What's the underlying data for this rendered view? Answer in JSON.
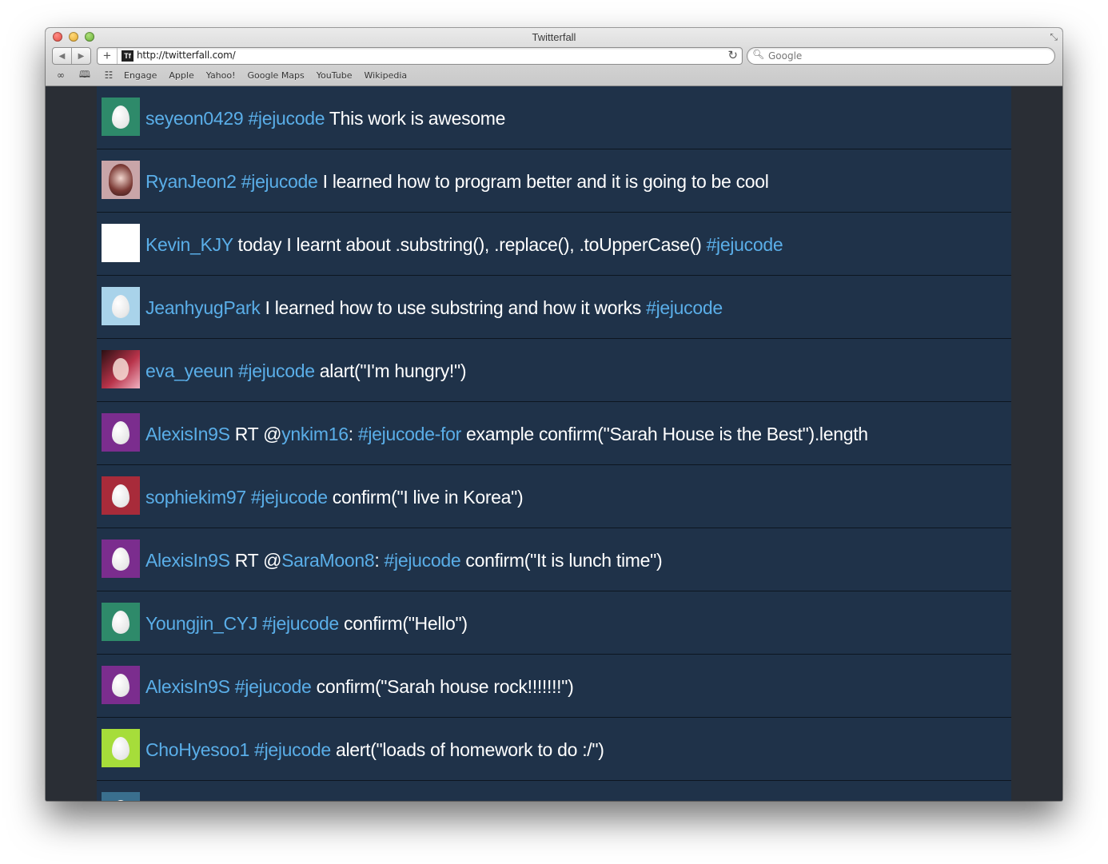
{
  "window": {
    "title": "Twitterfall"
  },
  "toolbar": {
    "back_icon": "back-arrow-icon",
    "forward_icon": "forward-arrow-icon",
    "favicon_text": "Tf",
    "url": "http://twitterfall.com/",
    "search_placeholder": "Google"
  },
  "bookmarks": [
    "Engage",
    "Apple",
    "Yahoo!",
    "Google Maps",
    "YouTube",
    "Wikipedia"
  ],
  "colors": {
    "feed_bg": "#1f3249",
    "link": "#5aaee8",
    "text": "#ffffff",
    "side_bg": "#2a2e35"
  },
  "tweets": [
    {
      "avatar": {
        "kind": "egg",
        "color": "#2e8a6a"
      },
      "segments": [
        {
          "t": "user",
          "v": "seyeon0429"
        },
        {
          "t": "text",
          "v": " "
        },
        {
          "t": "tag",
          "v": "#jejucode"
        },
        {
          "t": "text",
          "v": " This work is awesome"
        }
      ]
    },
    {
      "avatar": {
        "kind": "photo"
      },
      "segments": [
        {
          "t": "user",
          "v": "RyanJeon2"
        },
        {
          "t": "text",
          "v": " "
        },
        {
          "t": "tag",
          "v": "#jejucode"
        },
        {
          "t": "text",
          "v": " I learned how to program better and it is going to be cool"
        }
      ]
    },
    {
      "avatar": {
        "kind": "white"
      },
      "segments": [
        {
          "t": "user",
          "v": "Kevin_KJY"
        },
        {
          "t": "text",
          "v": " today I learnt about .substring(), .replace(), .toUpperCase() "
        },
        {
          "t": "tag",
          "v": "#jejucode"
        }
      ]
    },
    {
      "avatar": {
        "kind": "egg",
        "color": "#a9d3ea"
      },
      "segments": [
        {
          "t": "user",
          "v": "JeanhyugPark"
        },
        {
          "t": "text",
          "v": " I learned how to use substring and how it works "
        },
        {
          "t": "tag",
          "v": "#jejucode"
        }
      ]
    },
    {
      "avatar": {
        "kind": "pink"
      },
      "segments": [
        {
          "t": "user",
          "v": "eva_yeeun"
        },
        {
          "t": "text",
          "v": " "
        },
        {
          "t": "tag",
          "v": "#jejucode"
        },
        {
          "t": "text",
          "v": " alart(\"I'm hungry!\")"
        }
      ]
    },
    {
      "avatar": {
        "kind": "egg",
        "color": "#7b2d8e"
      },
      "segments": [
        {
          "t": "user",
          "v": "AlexisIn9S"
        },
        {
          "t": "text",
          "v": " RT @"
        },
        {
          "t": "mention",
          "v": "ynkim16"
        },
        {
          "t": "text",
          "v": ": "
        },
        {
          "t": "tag",
          "v": "#jejucode-for"
        },
        {
          "t": "text",
          "v": " example confirm(\"Sarah House is the Best\").length"
        }
      ]
    },
    {
      "avatar": {
        "kind": "egg",
        "color": "#a82b3a"
      },
      "segments": [
        {
          "t": "user",
          "v": "sophiekim97"
        },
        {
          "t": "text",
          "v": " "
        },
        {
          "t": "tag",
          "v": "#jejucode"
        },
        {
          "t": "text",
          "v": " confirm(\"I live in Korea\")"
        }
      ]
    },
    {
      "avatar": {
        "kind": "egg",
        "color": "#7b2d8e"
      },
      "segments": [
        {
          "t": "user",
          "v": "AlexisIn9S"
        },
        {
          "t": "text",
          "v": " RT @"
        },
        {
          "t": "mention",
          "v": "SaraMoon8"
        },
        {
          "t": "text",
          "v": ": "
        },
        {
          "t": "tag",
          "v": "#jejucode"
        },
        {
          "t": "text",
          "v": " confirm(\"It is lunch time\")"
        }
      ]
    },
    {
      "avatar": {
        "kind": "egg",
        "color": "#2e8a6a"
      },
      "segments": [
        {
          "t": "user",
          "v": "Youngjin_CYJ"
        },
        {
          "t": "text",
          "v": " "
        },
        {
          "t": "tag",
          "v": "#jejucode"
        },
        {
          "t": "text",
          "v": " confirm(\"Hello\")"
        }
      ]
    },
    {
      "avatar": {
        "kind": "egg",
        "color": "#7b2d8e"
      },
      "segments": [
        {
          "t": "user",
          "v": "AlexisIn9S"
        },
        {
          "t": "text",
          "v": " "
        },
        {
          "t": "tag",
          "v": "#jejucode"
        },
        {
          "t": "text",
          "v": " confirm(\"Sarah house rock!!!!!!!\")"
        }
      ]
    },
    {
      "avatar": {
        "kind": "egg",
        "color": "#a6dd3a"
      },
      "segments": [
        {
          "t": "user",
          "v": "ChoHyesoo1"
        },
        {
          "t": "text",
          "v": " "
        },
        {
          "t": "tag",
          "v": "#jejucode"
        },
        {
          "t": "text",
          "v": " alert(\"loads of homework to do :/\")"
        }
      ]
    },
    {
      "avatar": {
        "kind": "egg",
        "color": "#3a6f8e"
      },
      "segments": []
    }
  ]
}
